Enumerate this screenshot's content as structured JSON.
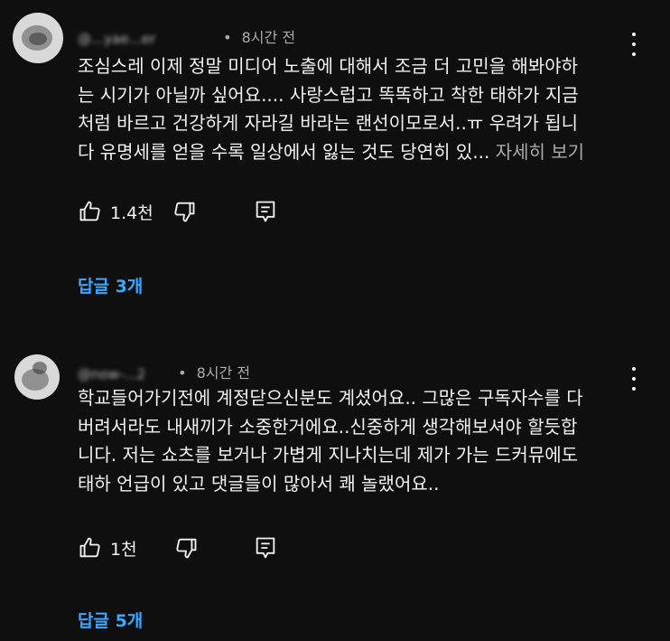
{
  "comments": [
    {
      "handle": "@...yae...er",
      "separator": "•",
      "time": "8시간 전",
      "lines": [
        "조심스레 이제 정말 미디어 노출에 대해서 조금 더 고민을 해봐야하",
        "는 시기가 아닐까 싶어요.... 사랑스럽고 똑똑하고 착한 태하가 지금",
        "처럼 바르고 건강하게 자라길 바라는 랜선이모로서..ㅠ 우려가 됩니",
        "다 유명세를 얻을 수록 일상에서 잃는 것도 당연히 있..."
      ],
      "more_label": "자세히 보기",
      "likes": "1.4천",
      "replies_label": "답글 3개"
    },
    {
      "handle": "@now-...2",
      "separator": "•",
      "time": "8시간 전",
      "lines": [
        "학교들어가기전에 계정닫으신분도 계셨어요.. 그많은 구독자수를 다",
        "버려서라도 내새끼가 소중한거에요..신중하게 생각해보셔야 할듯합",
        "니다. 저는 쇼츠를 보거나 가볍게 지나치는데 제가 가는 드커뮤에도",
        "태하 언급이 있고 댓글들이 많아서 쾌 놀랬어요.."
      ],
      "likes": "1천",
      "replies_label": "답글 5개"
    }
  ],
  "icons": {
    "like": "thumb-up-icon",
    "dislike": "thumb-down-icon",
    "reply": "reply-comment-icon",
    "menu": "more-vert-icon"
  },
  "colors": {
    "background": "#0f0f0f",
    "text": "#f1f1f1",
    "secondary": "#aaaaaa",
    "link": "#3ea6ff"
  }
}
